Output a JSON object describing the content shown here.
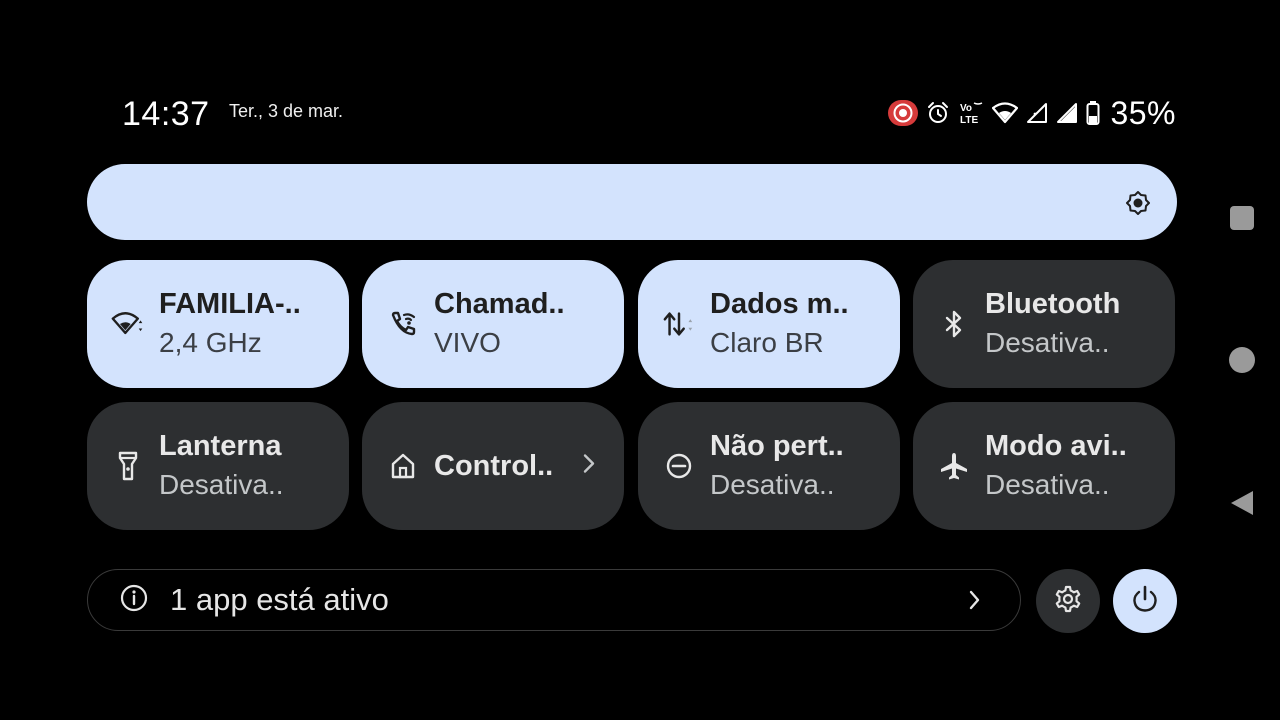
{
  "status_bar": {
    "time": "14:37",
    "date": "Ter., 3 de mar.",
    "battery_percent": "35%",
    "icons": [
      "screen-record-icon",
      "alarm-icon",
      "volte-icon",
      "wifi-icon",
      "signal-icon",
      "signal-icon",
      "battery-icon"
    ],
    "volte_label_top": "Vo",
    "volte_label_bottom": "LTE"
  },
  "brightness_slider": {
    "icon": "brightness-icon",
    "accent": "#d3e3fd"
  },
  "tiles": [
    {
      "id": "wifi",
      "title": "FAMILIA-..",
      "subtitle": "2,4 GHz",
      "state": "on",
      "icon": "wifi-icon"
    },
    {
      "id": "calling",
      "title": "Chamad..",
      "subtitle": "VIVO",
      "state": "on",
      "icon": "wifi-calling-icon"
    },
    {
      "id": "mobile-data",
      "title": "Dados m..",
      "subtitle": "Claro BR",
      "state": "on",
      "icon": "data-arrows-icon"
    },
    {
      "id": "bluetooth",
      "title": "Bluetooth",
      "subtitle": "Desativa..",
      "state": "off",
      "icon": "bluetooth-icon"
    },
    {
      "id": "flashlight",
      "title": "Lanterna",
      "subtitle": "Desativa..",
      "state": "off",
      "icon": "flashlight-icon"
    },
    {
      "id": "home-controls",
      "title": "Control..",
      "subtitle": "",
      "state": "off",
      "icon": "home-icon"
    },
    {
      "id": "dnd",
      "title": "Não pert..",
      "subtitle": "Desativa..",
      "state": "off",
      "icon": "do-not-disturb-icon"
    },
    {
      "id": "airplane",
      "title": "Modo avi..",
      "subtitle": "Desativa..",
      "state": "off",
      "icon": "airplane-icon"
    }
  ],
  "footer": {
    "active_apps_text": "1 app está ativo",
    "info_icon": "info-icon",
    "settings_icon": "gear-icon",
    "power_icon": "power-icon"
  },
  "colors": {
    "tile_on": "#d3e3fd",
    "tile_off": "#2d2f31",
    "background": "#000000",
    "record_badge": "#d63b3b"
  }
}
